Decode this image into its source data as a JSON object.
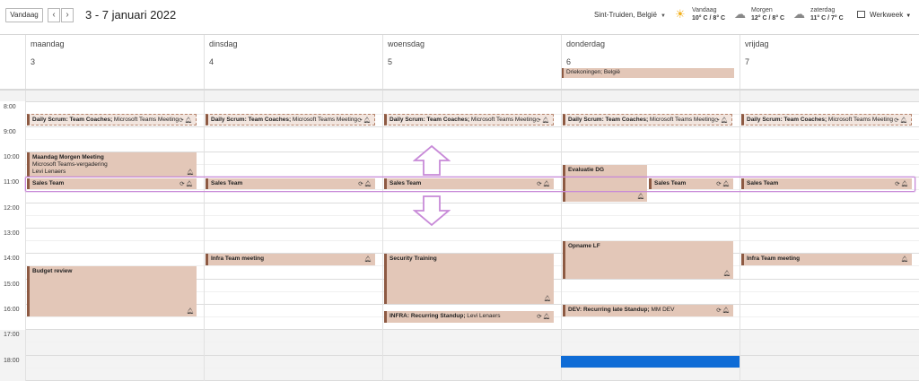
{
  "toolbar": {
    "today_label": "Vandaag",
    "prev_icon": "chevron-left-icon",
    "next_icon": "chevron-right-icon",
    "date_range": "3 - 7 januari 2022",
    "location": "Sint-Truiden, België",
    "view_label": "Werkweek"
  },
  "weather": [
    {
      "day": "Vandaag",
      "temp": "10° C / 8° C",
      "icon": "sun-cloud-icon"
    },
    {
      "day": "Morgen",
      "temp": "12° C / 8° C",
      "icon": "cloud-icon"
    },
    {
      "day": "zaterdag",
      "temp": "11° C / 7° C",
      "icon": "cloud-icon"
    }
  ],
  "days": [
    {
      "name": "maandag",
      "num": "3"
    },
    {
      "name": "dinsdag",
      "num": "4"
    },
    {
      "name": "woensdag",
      "num": "5"
    },
    {
      "name": "donderdag",
      "num": "6"
    },
    {
      "name": "vrijdag",
      "num": "7"
    }
  ],
  "hours": [
    "8:00",
    "9:00",
    "10:00",
    "11:00",
    "12:00",
    "13:00",
    "14:00",
    "15:00",
    "16:00",
    "17:00",
    "18:00"
  ],
  "allday": {
    "thu": "Driekoningen; België"
  },
  "events": {
    "scrum_title": "Daily Scrum: Team Coaches;",
    "scrum_loc": " Microsoft Teams Meeting",
    "sales": "Sales Team",
    "mon_meeting_title": "Maandag Morgen Meeting",
    "mon_meeting_loc": "Microsoft Teams-vergadering",
    "mon_meeting_person": "Levi Lenaers",
    "budget": "Budget review",
    "infra_tue": "Infra Team meeting",
    "security": "Security Training",
    "infra_standup_title": "INFRA: Recurring  Standup;",
    "infra_standup_person": " Levi Lenaers",
    "evaluatie": "Evaluatie DG",
    "opname": "Opname LF",
    "dev_title": "DEV: Recurring late Standup;",
    "dev_person": " MM DEV",
    "infra_fri": "Infra Team meeting"
  },
  "colors": {
    "event_bg": "#e3c7b8",
    "event_bar": "#8d5a43",
    "now": "#0f6cd6",
    "highlight": "#c88ad8"
  }
}
